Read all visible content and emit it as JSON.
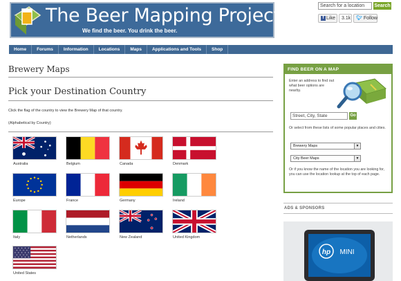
{
  "site": {
    "title": "The Beer Mapping Project",
    "tagline": "We find the beer. You drink the beer."
  },
  "top_search": {
    "placeholder": "Search for a location",
    "button": "Search"
  },
  "social": {
    "like": "Like",
    "like_count": "3.1k",
    "follow": "Follow"
  },
  "nav": {
    "items": [
      "Home",
      "Forums",
      "Information",
      "Locations",
      "Maps",
      "Applications and Tools",
      "Shop"
    ]
  },
  "main": {
    "heading": "Brewery Maps",
    "subheading": "Pick your Destination Country",
    "instructions": "Click the flag of the country to view the Brewery Map of that country.",
    "sort_note": "(Alphabetical by Country)",
    "countries": [
      "Australia",
      "Belgium",
      "Canada",
      "Denmark",
      "Europe",
      "France",
      "Germany",
      "Ireland",
      "Italy",
      "Netherlands",
      "New Zealand",
      "United Kingdom",
      "United States"
    ]
  },
  "sidebar": {
    "heading": "FIND BEER ON A MAP",
    "intro": "Enter an address to find out what beer options are nearby.",
    "address_placeholder": "Street, City, State",
    "go": "Go",
    "lists_text": "Or select from these lists of some popular places and cities.",
    "select1": "Brewery Maps",
    "select2": "City Beer Maps",
    "footer_text": "Or if you know the name of the location you are looking for, you can use the location lookup at the top of each page."
  },
  "ads": {
    "heading": "ADS & SPONSORS",
    "brand": "hp",
    "product": "MINI"
  },
  "colors": {
    "nav": "#3f6894",
    "banner": "#3d6a9a",
    "accent_green": "#77a043"
  }
}
